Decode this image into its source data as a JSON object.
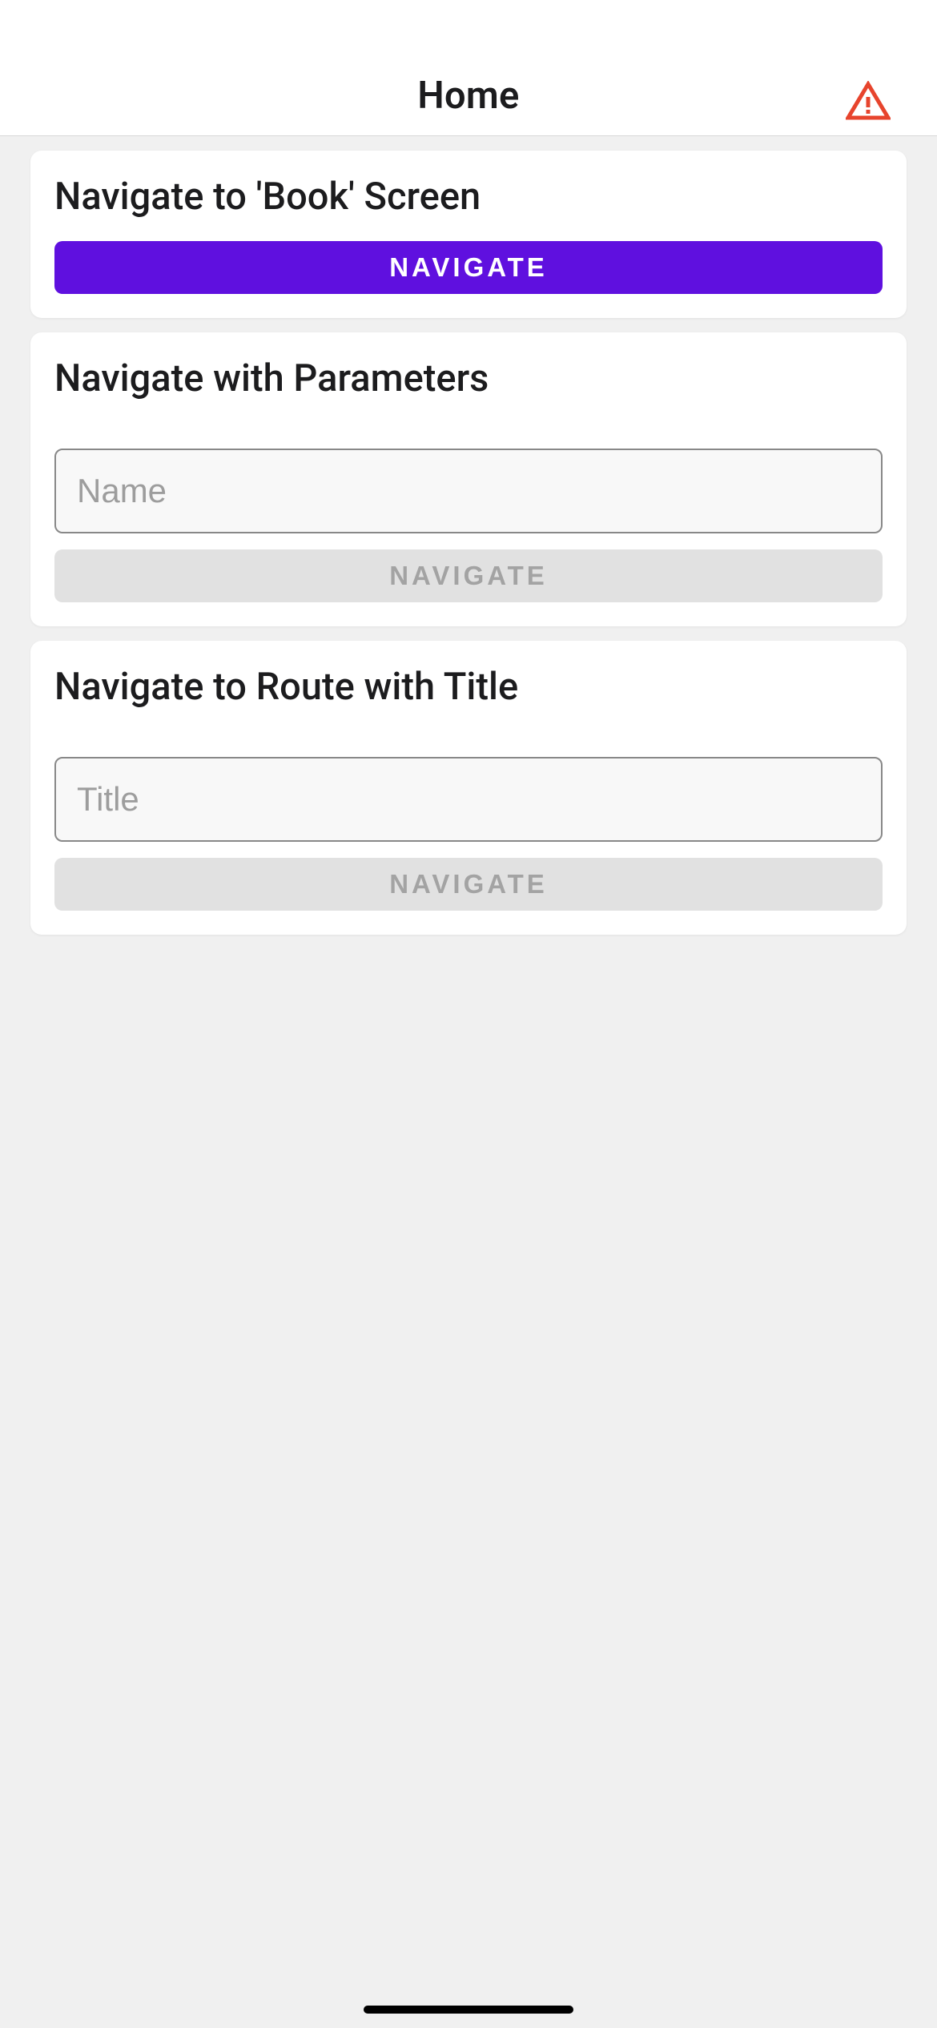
{
  "header": {
    "title": "Home"
  },
  "cards": {
    "book": {
      "title": "Navigate to 'Book' Screen",
      "button_label": "NAVIGATE"
    },
    "params": {
      "title": "Navigate with Parameters",
      "name_placeholder": "Name",
      "name_value": "",
      "button_label": "NAVIGATE"
    },
    "route_title": {
      "title": "Navigate to Route with Title",
      "title_placeholder": "Title",
      "title_value": "",
      "button_label": "NAVIGATE"
    }
  },
  "colors": {
    "primary": "#5f10df",
    "disabled_bg": "#e1e1e1",
    "disabled_fg": "#a3a3a3",
    "warning": "#e7442d"
  }
}
